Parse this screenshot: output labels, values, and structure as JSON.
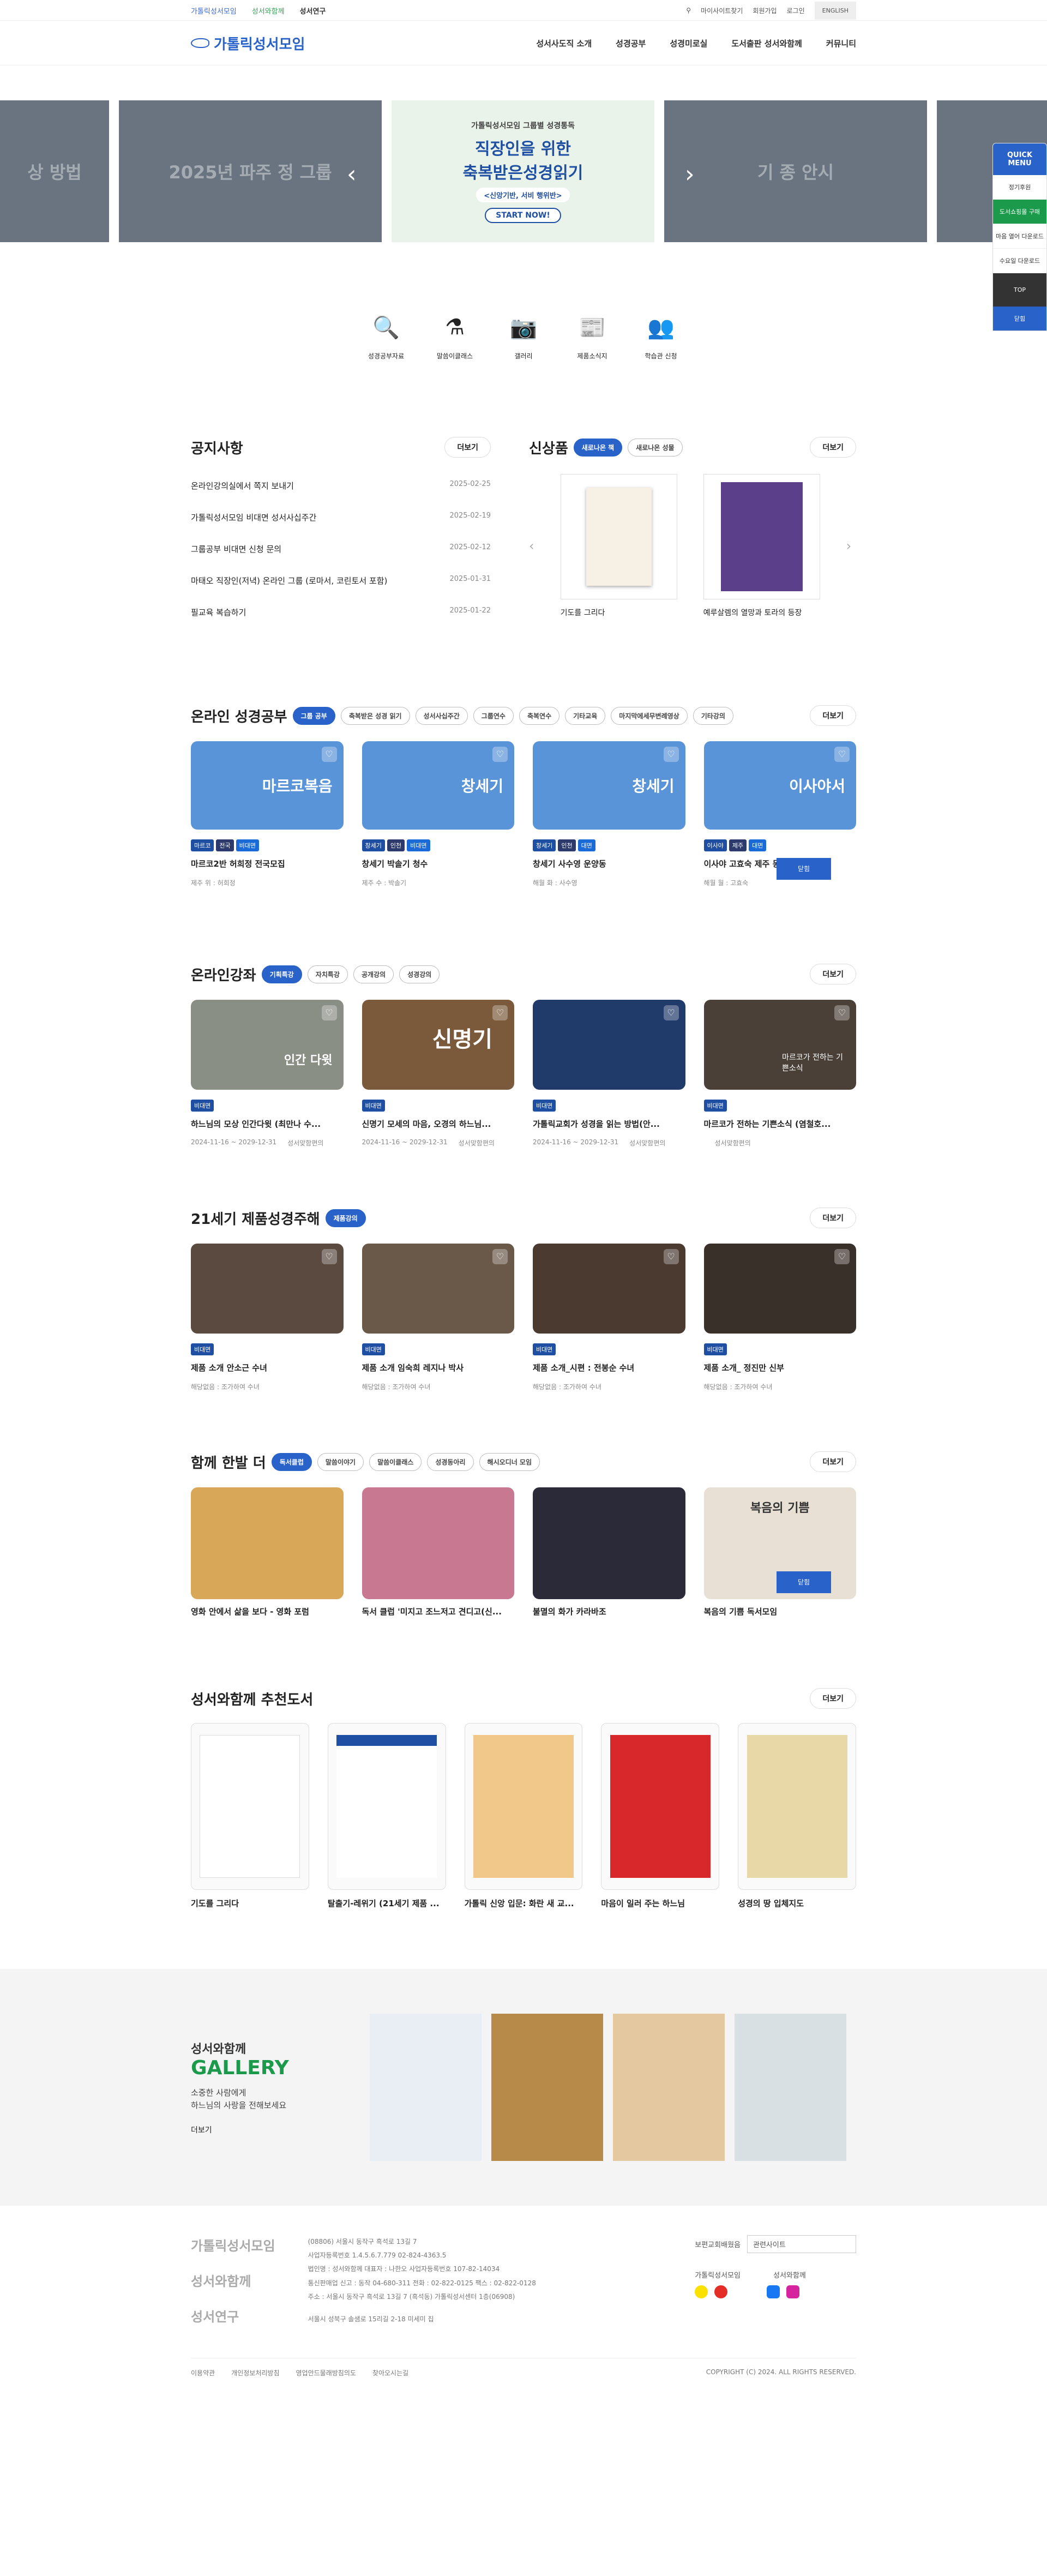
{
  "util": {
    "sites": [
      "가톨릭성서모임",
      "성서와함께",
      "성서연구"
    ],
    "links": [
      "마이사이트찾기",
      "회원가입",
      "로그인"
    ],
    "lang": "ENGLISH"
  },
  "header": {
    "logo": "가톨릭성서모임",
    "menu": [
      "성서사도직 소개",
      "성경공부",
      "성경미로실",
      "도서출판 성서와함께",
      "커뮤니티"
    ]
  },
  "banner": {
    "left1": "상 방법",
    "left2": "2025년 파주 정 그룹",
    "right1": "기 종 안시",
    "right2": "",
    "center": {
      "t1": "가톨릭성서모임 그룹별 성경통독",
      "t2": "직장인을 위한\n축복받은성경읽기",
      "t3": "<신앙기반, 서비 행위반>",
      "btn": "START NOW!"
    }
  },
  "quick": {
    "title": "QUICK MENU",
    "items": [
      "정기후원",
      "도서쇼핑몰 구매",
      "마음 열어 다운로드",
      "수요일 다운로드"
    ],
    "top": "TOP",
    "close": "닫힘"
  },
  "shortcuts": [
    "성경공부자료",
    "말씀이클래스",
    "갤러리",
    "제품소식지",
    "학습관 신청"
  ],
  "notice": {
    "title": "공지사항",
    "more": "더보기",
    "items": [
      {
        "t": "온라인강의실에서 쪽지 보내기",
        "d": "2025-02-25"
      },
      {
        "t": "가톨릭성서모임 비대면 성서사십주간",
        "d": "2025-02-19"
      },
      {
        "t": "그룹공부 비대면 신청 문의",
        "d": "2025-02-12"
      },
      {
        "t": "마태오 직장인(저녁) 온라인 그룹 (로마서, 코린토서 포함)",
        "d": "2025-01-31"
      },
      {
        "t": "필교육 복습하기",
        "d": "2025-01-22"
      }
    ]
  },
  "newp": {
    "title": "신상품",
    "tabs": [
      "새로나온 책",
      "새로나온 성물"
    ],
    "more": "더보기",
    "items": [
      "기도를 그리다",
      "예루살렘의 열망과 토라의 등장"
    ]
  },
  "study": {
    "title": "온라인 성경공부",
    "more": "더보기",
    "tabs": [
      "그룹 공부",
      "축복받은 성경 읽기",
      "성서사십주간",
      "그룹연수",
      "축복연수",
      "기타교육",
      "마지막에세무변례영상",
      "기타강의"
    ],
    "cards": [
      {
        "label": "마르코복음",
        "tags": [
          "마르코",
          "전국",
          "비대면"
        ],
        "t": "마르코2반 허희정 전국모집",
        "m": "제주 위 : 허희정"
      },
      {
        "label": "창세기",
        "tags": [
          "창세기",
          "인천",
          "비대면"
        ],
        "t": "창세기 박솔기 청수",
        "m": "제주 수 : 박솔기"
      },
      {
        "label": "창세기",
        "tags": [
          "창세기",
          "인천",
          "대면"
        ],
        "t": "창세기 사수영 운양동",
        "m": "해월 화 : 사수영"
      },
      {
        "label": "이사야서",
        "tags": [
          "이사야",
          "제주",
          "대면"
        ],
        "t": "이사야 고효숙 제주 동광",
        "m": "해월 월 : 고효숙"
      }
    ]
  },
  "lecture": {
    "title": "온라인강좌",
    "more": "더보기",
    "tabs": [
      "기획특강",
      "자치특강",
      "공개강의",
      "성경강의"
    ],
    "cards": [
      {
        "over": "인간 다윗",
        "t": "하느님의 모상 인간다윗 (최만나 수...",
        "d": "2024-11-16 ~ 2029-12-31",
        "a": "성서맞함편의"
      },
      {
        "over": "신명기",
        "t": "신명기 모세의 마음, 오경의 하느님...",
        "d": "2024-11-16 ~ 2029-12-31",
        "a": "성서맞함편의"
      },
      {
        "over": "",
        "t": "가톨릭교회가 성경을 읽는 방법(안...",
        "d": "2024-11-16 ~ 2029-12-31",
        "a": "성서맞함편의"
      },
      {
        "over": "마르코가 전하는 기쁜소식",
        "t": "마르코가 전하는 기쁜소식 (염철호...",
        "d": "",
        "a": "성서맞함편의"
      }
    ]
  },
  "c21": {
    "title": "21세기 제품성경주해",
    "tab": "제품강의",
    "more": "더보기",
    "cards": [
      {
        "t": "제품 소개 안소근 수녀",
        "m": "해당없음 : 조가하여 수녀"
      },
      {
        "t": "제품 소개 임숙희 레지나 박사",
        "m": "해당없음 : 조가하여 수녀"
      },
      {
        "t": "제품 소개_시편 : 전봉순 수녀",
        "m": "해당없음 : 조가하여 수녀"
      },
      {
        "t": "제품 소개_ 정진만 신부",
        "m": "해당없음 : 조가하여 수녀"
      }
    ],
    "tag": "비대면"
  },
  "together": {
    "title": "함께 한발 더",
    "more": "더보기",
    "tabs": [
      "독서클럽",
      "말씀이야기",
      "말씀이클래스",
      "성경동아리",
      "해시오디너 모임"
    ],
    "cards": [
      "영화 안에서 삶을 보다 - 영화 포럼",
      "독서 클럽 '미지고 조느저고 견디고(신...",
      "불멸의 화가 카라바조",
      "복음의 기쁨 독서모임"
    ],
    "overs": [
      "",
      "",
      "",
      "복음의 기쁨"
    ]
  },
  "recbooks": {
    "title": "성서와함께 추천도서",
    "more": "더보기",
    "items": [
      "기도를 그리다",
      "탈출기-레위기 (21세기 제품 ...",
      "가톨릭 신앙 입문: 화란 새 교...",
      "마음이 일러 주는 하느님",
      "성경의 땅 입체지도"
    ]
  },
  "gallery": {
    "t1": "성서와함께",
    "t2": "GALLERY",
    "t3": "소중한 사람에게\n하느님의 사랑을 전해보세요",
    "more": "더보기"
  },
  "footer": {
    "logos": [
      "가톨릭성서모임",
      "성서와함께",
      "성서연구"
    ],
    "info": [
      "(08806) 서울시 동작구 흑석로 13길 7",
      "사업자등록번호 1.4.5.6.7.779 02-824-4363.5",
      "법인명 : 성서와함께  대표자 : 나한오  사업자등록번호 107-82-14034",
      "통신판매업 신고 : 동작 04-680-311  전화 : 02-822-0125  팩스 : 02-822-0128",
      "주소 : 서울시 동작구 흑석로 13길 7 (흑석동) 가톨릭성서센터 1층(06908)",
      "서울시 성북구 솔샘로 15리길 2-18 미세미 집"
    ],
    "select_label": "보편교회배웠음",
    "select": "관련사이트",
    "sns": [
      "가톨릭성서모임",
      "성서와함께"
    ],
    "links": [
      "이용약관",
      "개인정보처리방침",
      "영업안드물래방침의도",
      "찾아오시는길"
    ],
    "copy": "COPYRIGHT (C) 2024. ALL RIGHTS RESERVED."
  }
}
